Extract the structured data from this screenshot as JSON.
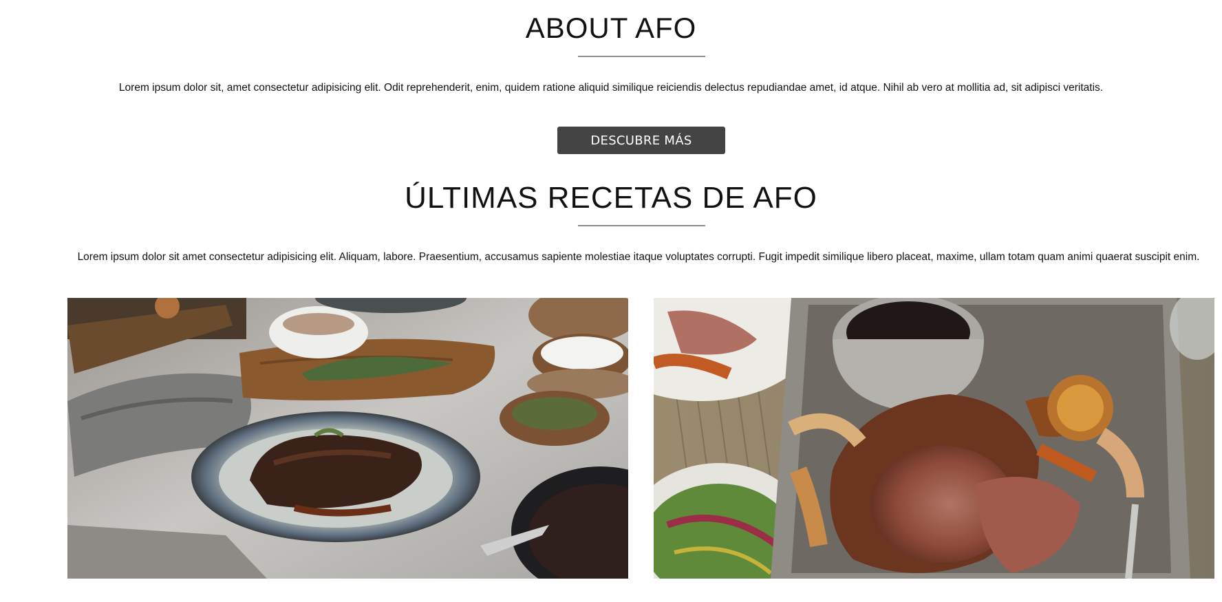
{
  "about": {
    "title": "ABOUT AFO",
    "text": "Lorem ipsum dolor sit, amet consectetur adipisicing elit. Odit reprehenderit, enim, quidem ratione aliquid similique reiciendis delectus repudiandae amet, id atque. Nihil ab vero at mollitia ad, sit adipisci veritatis.",
    "button_label": "DESCUBRE MÁS"
  },
  "recipes": {
    "title": "ÚLTIMAS RECETAS DE AFO",
    "text": "Lorem ipsum dolor sit amet consectetur adipisicing elit. Aliquam, labore. Praesentium, accusamus sapiente molestiae itaque voluptates corrupti. Fugit impedit similique libero placeat, maxime, ullam totam quam animi quaerat suscipit enim.",
    "images": [
      {
        "subject": "braised-meat-plate-photo"
      },
      {
        "subject": "roast-beef-tray-photo"
      }
    ]
  },
  "colors": {
    "button_bg": "#444444",
    "button_text": "#ffffff",
    "divider": "#8d8d8d",
    "text": "#111111"
  }
}
